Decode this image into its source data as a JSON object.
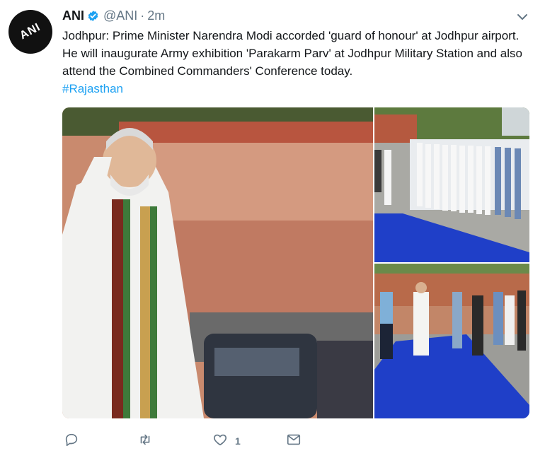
{
  "account": {
    "name": "ANI",
    "handle": "@ANI",
    "separator": "·",
    "time": "2m",
    "avatar_text": "ANI"
  },
  "tweet": {
    "text": "Jodhpur: Prime Minister Narendra Modi accorded 'guard of honour' at Jodhpur airport. He will inaugurate Army exhibition 'Parakarm Parv' at Jodhpur Military Station and also attend the Combined Commanders' Conference today.",
    "hashtag": "#Rajasthan"
  },
  "actions": {
    "reply_count": "",
    "retweet_count": "",
    "like_count": "1",
    "message_count": ""
  },
  "icons": {
    "verified": "verified-badge-icon",
    "caret": "chevron-down-icon",
    "reply": "reply-icon",
    "retweet": "retweet-icon",
    "like": "heart-icon",
    "message": "envelope-icon"
  },
  "colors": {
    "link": "#1da1f2",
    "muted": "#657786",
    "text": "#14171a",
    "carpet": "#1f3fc8"
  }
}
